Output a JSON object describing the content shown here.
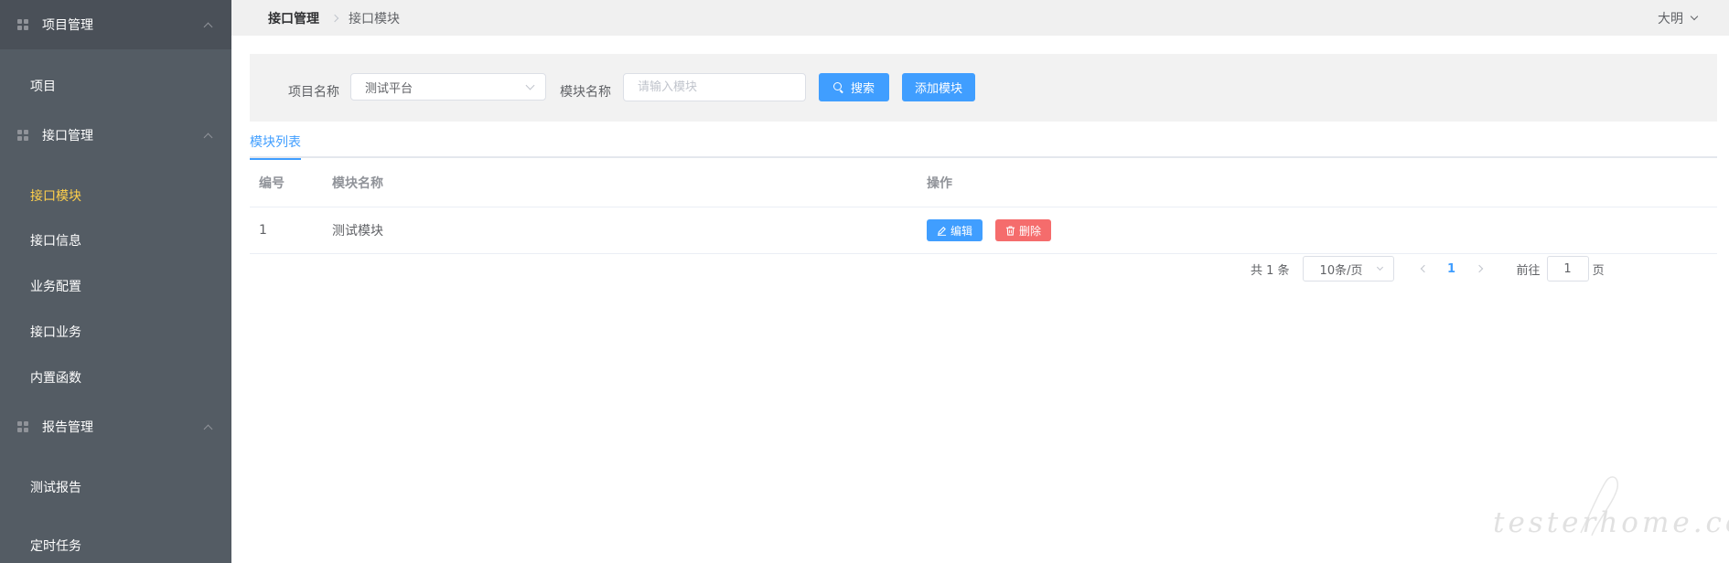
{
  "sidebar": {
    "groups": [
      {
        "label": "项目管理",
        "items": [
          "项目"
        ]
      },
      {
        "label": "接口管理",
        "items": [
          "接口模块",
          "接口信息",
          "业务配置",
          "接口业务",
          "内置函数"
        ]
      },
      {
        "label": "报告管理",
        "items": [
          "测试报告",
          "定时任务"
        ]
      }
    ],
    "active_item": "接口模块"
  },
  "header": {
    "breadcrumb": [
      "接口管理",
      "接口模块"
    ],
    "user": "大明"
  },
  "search": {
    "project_label": "项目名称",
    "project_value": "测试平台",
    "module_label": "模块名称",
    "module_placeholder": "请输入模块",
    "search_button": "搜索",
    "add_button": "添加模块"
  },
  "tabs": [
    "模块列表"
  ],
  "table": {
    "columns": [
      "编号",
      "模块名称",
      "操作"
    ],
    "rows": [
      {
        "no": "1",
        "name": "测试模块",
        "edit": "编辑",
        "delete": "删除"
      }
    ]
  },
  "pagination": {
    "total": "共 1 条",
    "page_size": "10条/页",
    "current_page": "1",
    "jump_prefix": "前往",
    "jump_value": "1",
    "jump_suffix": "页"
  },
  "watermark": "testerhome.com",
  "colors": {
    "sidebar_bg": "#545c64",
    "active_menu": "#ffd04b",
    "primary": "#409eff",
    "danger": "#f56c6c"
  }
}
